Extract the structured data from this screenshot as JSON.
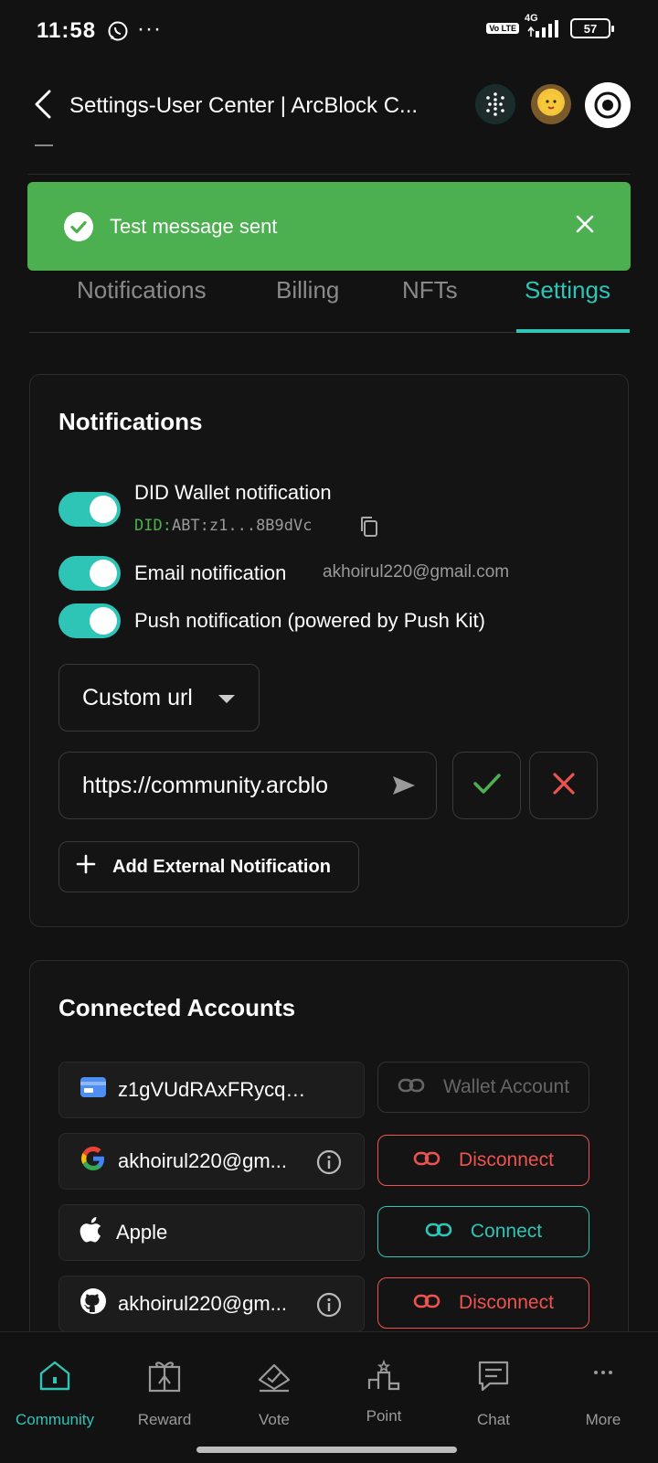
{
  "status_bar": {
    "time": "11:58",
    "dots": "···",
    "volte": "Vo LTE",
    "network": "4G",
    "battery": "57"
  },
  "header": {
    "title": "Settings-User Center | ArcBlock C..."
  },
  "toast": {
    "message": "Test message sent",
    "color": "#4caf50"
  },
  "tabs": [
    {
      "label": "Notifications",
      "active": false
    },
    {
      "label": "Billing",
      "active": false
    },
    {
      "label": "NFTs",
      "active": false
    },
    {
      "label": "Settings",
      "active": true
    }
  ],
  "notifications": {
    "title": "Notifications",
    "did_wallet": {
      "label": "DID Wallet notification",
      "did_prefix": "DID:",
      "did_value": "ABT:z1...8B9dVc",
      "enabled": true
    },
    "email": {
      "label": "Email notification",
      "value": "akhoirul220@gmail.com",
      "enabled": true
    },
    "push": {
      "label": "Push notification (powered by Push Kit)",
      "enabled": true
    },
    "select": {
      "selected": "Custom url"
    },
    "url_input": {
      "value": "https://community.arcblo"
    },
    "add_button": "Add External Notification"
  },
  "connected_accounts": {
    "title": "Connected Accounts",
    "items": [
      {
        "icon": "wallet-icon",
        "text": "z1gVUdRAxFRycqnjUj...",
        "action": "Wallet Account",
        "style": "grey",
        "info": false
      },
      {
        "icon": "google-icon",
        "text": "akhoirul220@gm...",
        "action": "Disconnect",
        "style": "red",
        "info": true
      },
      {
        "icon": "apple-icon",
        "text": "Apple",
        "action": "Connect",
        "style": "teal",
        "info": false
      },
      {
        "icon": "github-icon",
        "text": "akhoirul220@gm...",
        "action": "Disconnect",
        "style": "red",
        "info": true
      }
    ]
  },
  "bottom_nav": [
    {
      "label": "Community",
      "icon": "home-icon",
      "active": true
    },
    {
      "label": "Reward",
      "icon": "gift-icon",
      "active": false
    },
    {
      "label": "Vote",
      "icon": "vote-icon",
      "active": false
    },
    {
      "label": "Point",
      "icon": "podium-icon",
      "active": false
    },
    {
      "label": "Chat",
      "icon": "chat-icon",
      "active": false
    },
    {
      "label": "More",
      "icon": "more-icon",
      "active": false
    }
  ],
  "colors": {
    "accent": "#2ec4b6",
    "danger": "#ef5350",
    "success": "#4caf50",
    "background": "#121212"
  }
}
